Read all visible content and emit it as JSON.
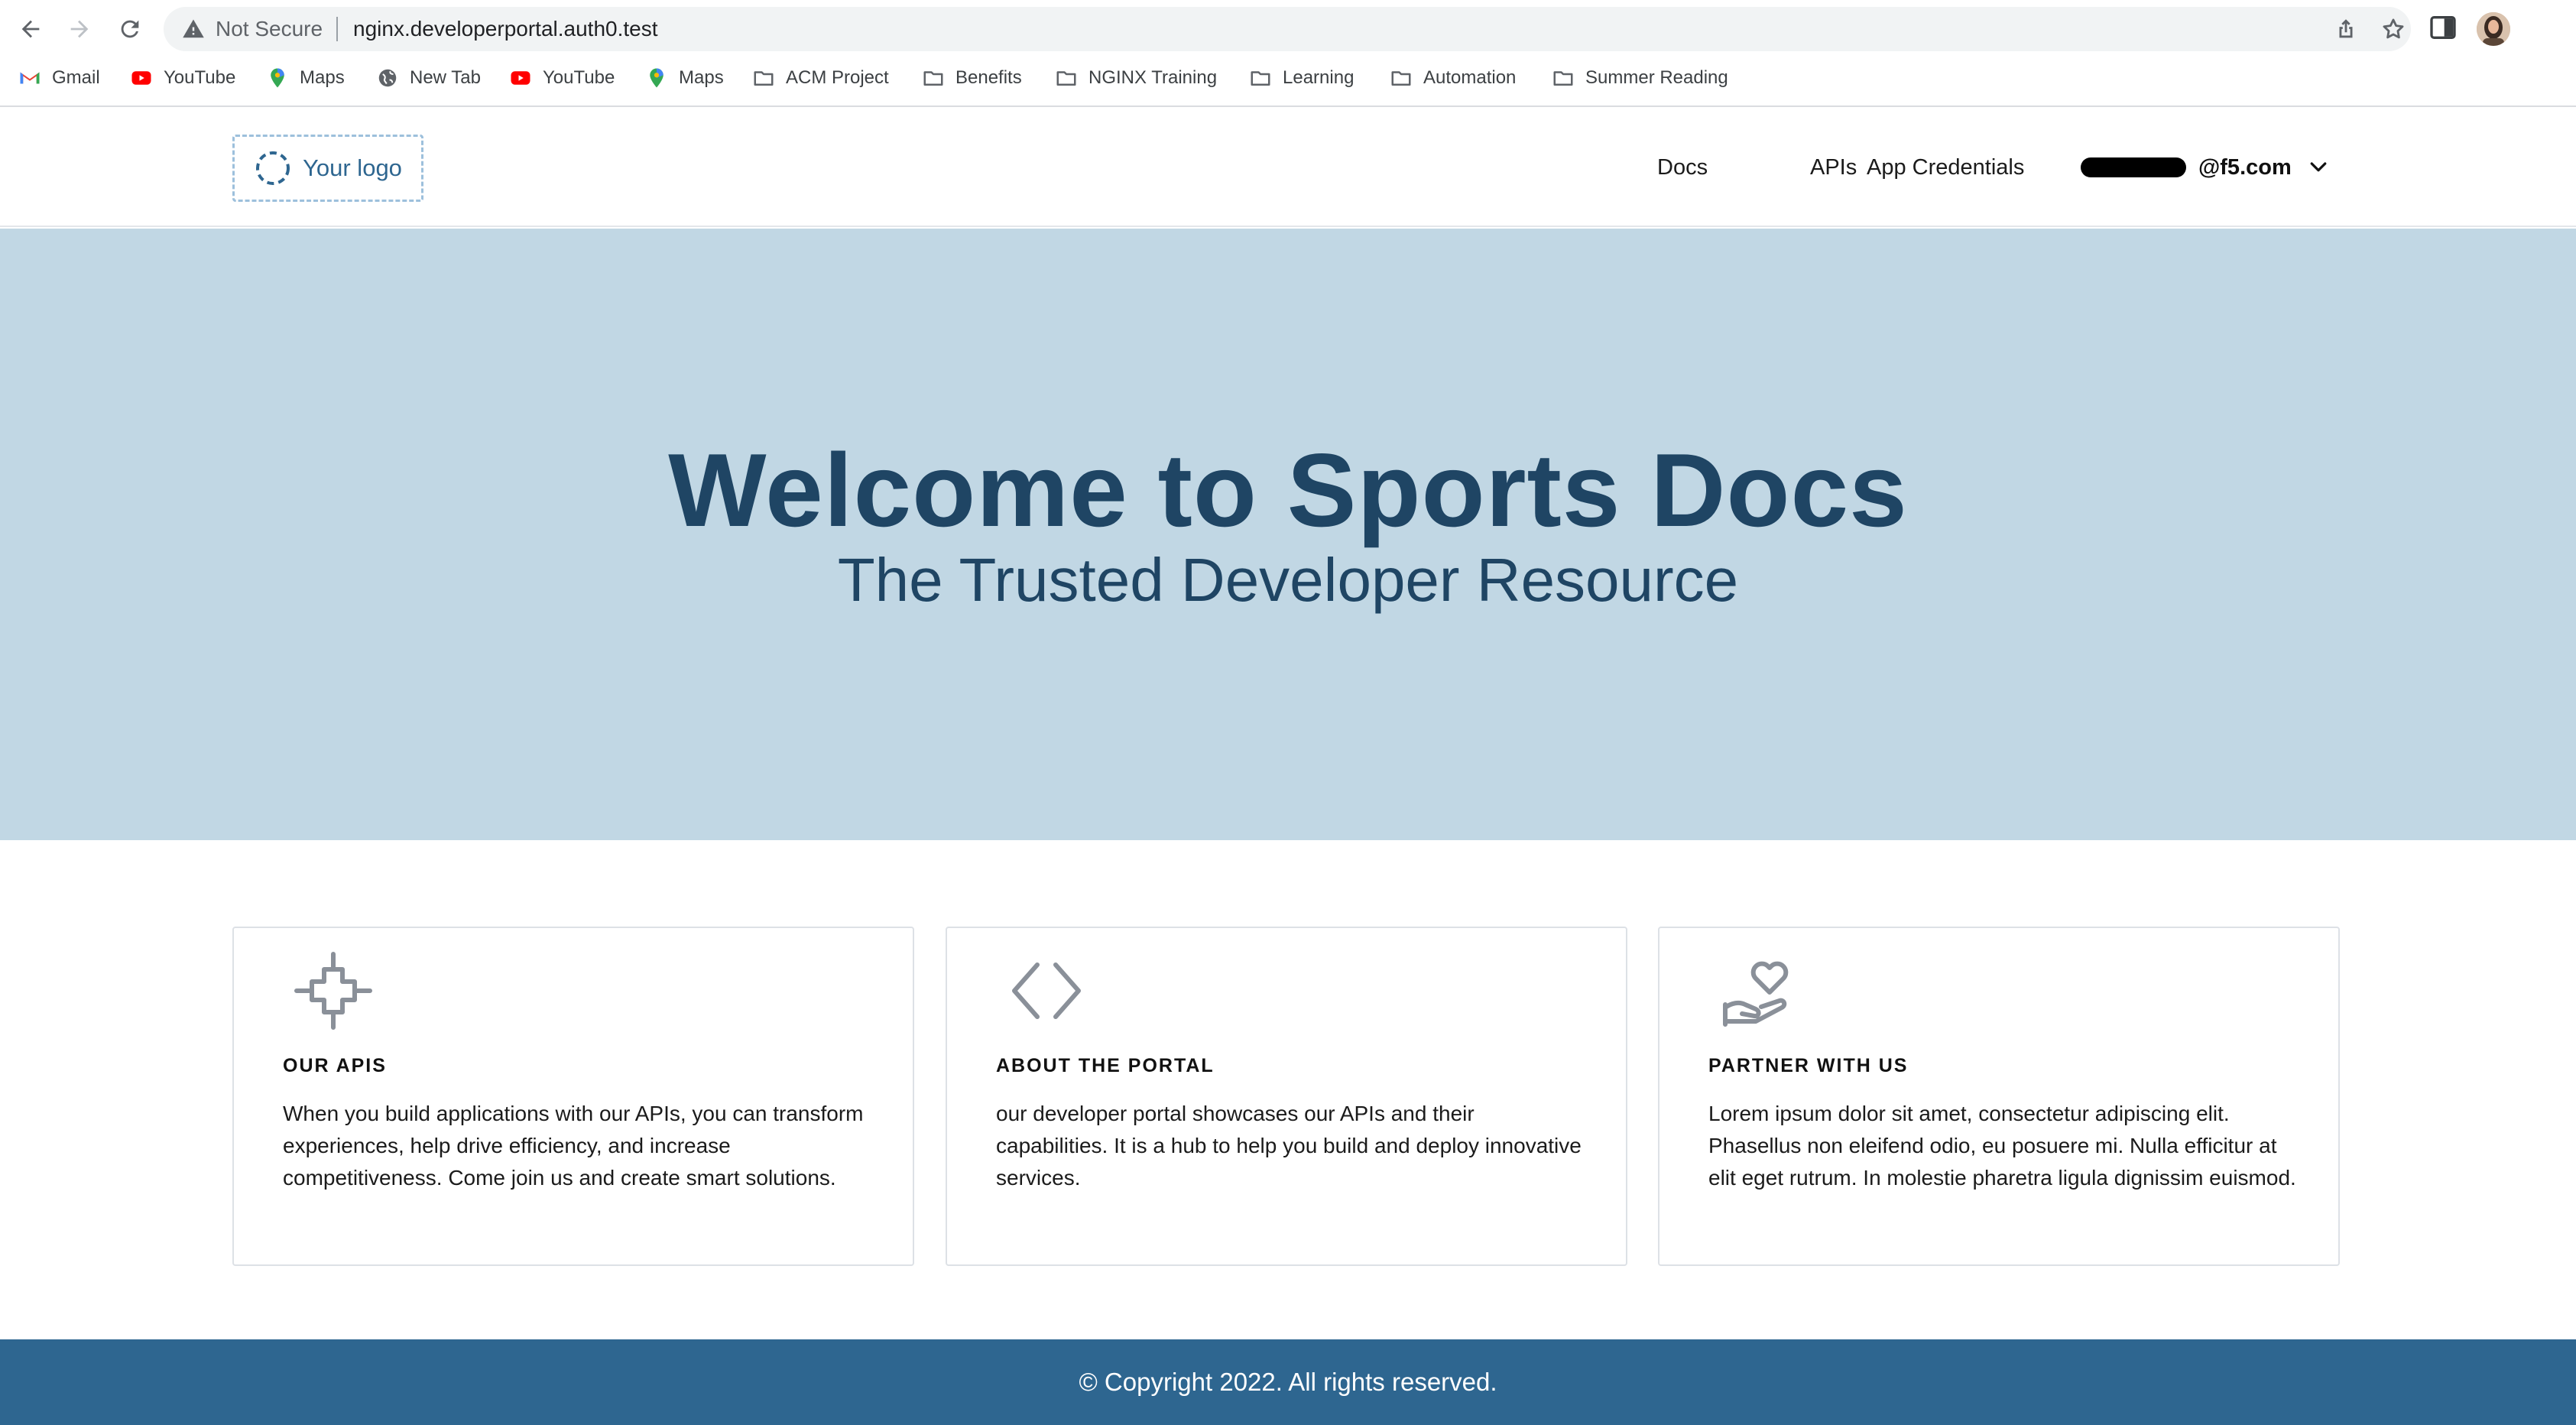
{
  "browser": {
    "security_label": "Not Secure",
    "url": "nginx.developerportal.auth0.test",
    "bookmarks": [
      {
        "label": "Gmail",
        "icon": "gmail-icon"
      },
      {
        "label": "YouTube",
        "icon": "youtube-icon"
      },
      {
        "label": "Maps",
        "icon": "maps-icon"
      },
      {
        "label": "New Tab",
        "icon": "globe-icon"
      },
      {
        "label": "YouTube",
        "icon": "youtube-icon"
      },
      {
        "label": "Maps",
        "icon": "maps-icon"
      },
      {
        "label": "ACM Project",
        "icon": "folder-icon"
      },
      {
        "label": "Benefits",
        "icon": "folder-icon"
      },
      {
        "label": "NGINX Training",
        "icon": "folder-icon"
      },
      {
        "label": "Learning",
        "icon": "folder-icon"
      },
      {
        "label": "Automation",
        "icon": "folder-icon"
      },
      {
        "label": "Summer Reading",
        "icon": "folder-icon"
      }
    ]
  },
  "header": {
    "logo_text": "Your logo",
    "nav": [
      {
        "label": "Docs"
      },
      {
        "label": "APIs"
      },
      {
        "label": "App Credentials"
      }
    ],
    "user_email": "@f5.com"
  },
  "hero": {
    "title": "Welcome to Sports Docs",
    "subtitle": "The Trusted Developer Resource"
  },
  "cards": [
    {
      "icon": "crosshair-plus-icon",
      "title": "OUR APIS",
      "body": "When you build applications with our APIs, you can transform experiences, help drive efficiency, and increase competitiveness. Come join us and create smart solutions."
    },
    {
      "icon": "code-brackets-icon",
      "title": "ABOUT THE PORTAL",
      "body": "our developer portal showcases our APIs and their capabilities. It is a hub to help you build and deploy innovative services."
    },
    {
      "icon": "heart-hand-icon",
      "title": "PARTNER WITH US",
      "body": "Lorem ipsum dolor sit amet, consectetur adipiscing elit. Phasellus non eleifend odio, eu posuere mi. Nulla efficitur at elit eget rutrum. In molestie pharetra ligula dignissim euismod."
    }
  ],
  "footer": {
    "text": "© Copyright 2022. All rights reserved."
  },
  "colors": {
    "hero_bg": "#c1d7e4",
    "hero_text": "#1f4564",
    "footer_bg": "#2e6690",
    "logo_text": "#2e6690"
  }
}
